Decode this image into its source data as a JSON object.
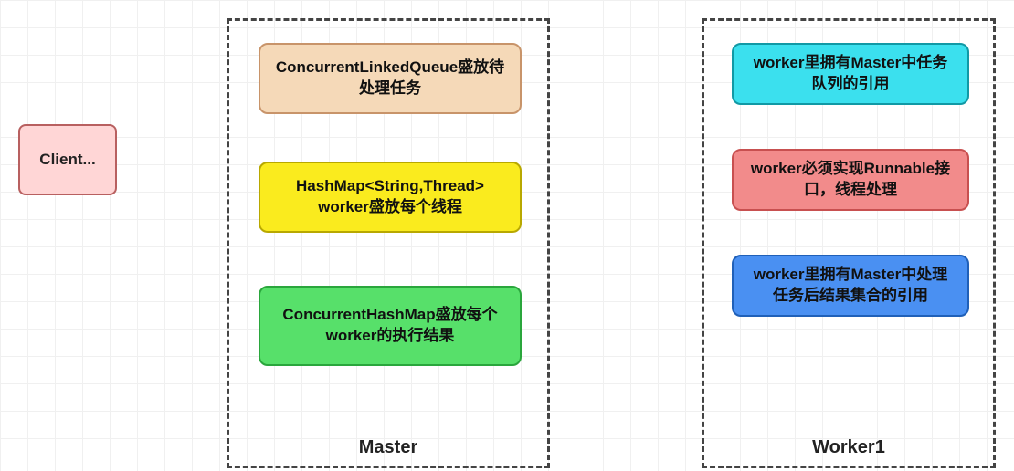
{
  "client": {
    "label": "Client..."
  },
  "master": {
    "label": "Master",
    "boxes": [
      {
        "text": "ConcurrentLinkedQueue盛放待处理任务"
      },
      {
        "text": "HashMap<String,Thread> worker盛放每个线程"
      },
      {
        "text": "ConcurrentHashMap盛放每个worker的执行结果"
      }
    ]
  },
  "worker": {
    "label": "Worker1",
    "boxes": [
      {
        "text": "worker里拥有Master中任务队列的引用"
      },
      {
        "text": "worker必须实现Runnable接口，线程处理"
      },
      {
        "text": "worker里拥有Master中处理任务后结果集合的引用"
      }
    ]
  },
  "colors": {
    "clientBg": "#ffd6d6",
    "masterBox1": "#f5d9b8",
    "masterBox2": "#faeb1e",
    "masterBox3": "#57e06a",
    "workerBox1": "#3be0ee",
    "workerBox2": "#f28b8b",
    "workerBox3": "#4a90f2"
  }
}
